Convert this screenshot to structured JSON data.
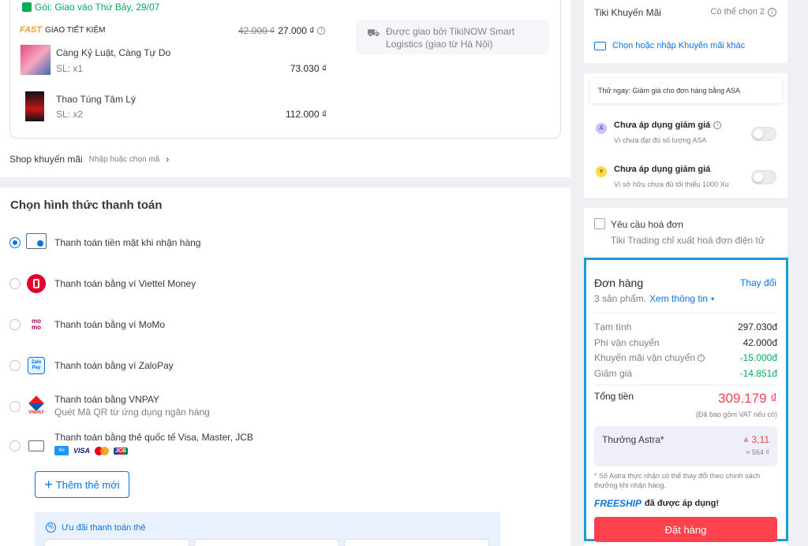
{
  "colors": {
    "accent": "#0b74e5",
    "price_red": "#ff424e",
    "green": "#00ab56",
    "highlight_border": "#1a9bd7",
    "order_button": "#ff424e"
  },
  "package": {
    "delivery_label": "Gói: Giao vào Thứ Bảy, 29/07",
    "fast_tag": "FAST",
    "shipping_method": "GIAO TIẾT KIỆM",
    "old_fee": "42.000 ₫",
    "new_fee": "27.000 ₫",
    "carrier": "Được giao bởi TikiNOW Smart Logistics (giao từ Hà Nội)",
    "items": [
      {
        "name": "Càng Kỷ Luật, Càng Tự Do",
        "qty": "SL: x1",
        "price": "73.030 ₫"
      },
      {
        "name": "Thao Túng Tâm Lý",
        "qty": "SL: x2",
        "price": "112.000 ₫"
      }
    ]
  },
  "shop_promo": {
    "label": "Shop khuyến mãi",
    "hint": "Nhập hoặc chọn mã"
  },
  "payment": {
    "title": "Chọn hình thức thanh toán",
    "options": [
      {
        "label": "Thanh toán tiền mặt khi nhận hàng",
        "icon": "cash-icon"
      },
      {
        "label": "Thanh toán bằng ví Viettel Money",
        "icon": "viettel-money-icon"
      },
      {
        "label": "Thanh toán bằng ví MoMo",
        "icon": "momo-icon",
        "icon_text": "mo mo"
      },
      {
        "label": "Thanh toán bằng ví ZaloPay",
        "icon": "zalopay-icon",
        "icon_text": "Zalo Pay"
      },
      {
        "label": "Thanh toán bằng VNPAY",
        "sub": "Quét Mã QR từ ứng dụng ngân hàng",
        "icon": "vnpay-icon",
        "icon_text": "VNPAY"
      },
      {
        "label": "Thanh toán bằng thẻ quốc tế Visa, Master, JCB",
        "icon": "credit-card-icon",
        "cards": [
          "tiki",
          "VISA",
          "MC",
          "JCB"
        ]
      }
    ],
    "add_card": "Thêm thẻ mới",
    "card_offer": "Ưu đãi thanh toán thẻ"
  },
  "sidebar": {
    "tiki_promo": {
      "label": "Tiki Khuyến Mãi",
      "count": "Có thể chọn 2",
      "link": "Chọn hoặc nhập Khuyến mãi khác"
    },
    "asa": {
      "tip": "Thử ngay: Giảm giá cho đơn hàng bằng ASA",
      "items": [
        {
          "title": "Chưa áp dụng giảm giá",
          "sub": "Vì chưa đạt đủ số lượng ASA"
        },
        {
          "title": "Chưa áp dụng giảm giá",
          "sub": "Vì sở hữu chưa đủ tối thiểu 1000 Xu"
        }
      ]
    },
    "invoice": {
      "label": "Yêu cầu hoá đơn",
      "note": "Tiki Trading chỉ xuất hoá đơn điện tử"
    },
    "order": {
      "title": "Đơn hàng",
      "change": "Thay đổi",
      "products": "3 sản phẩm.",
      "view_info": "Xem thông tin",
      "lines": [
        {
          "label": "Tạm tính",
          "value": "297.030đ"
        },
        {
          "label": "Phí vận chuyển",
          "value": "42.000đ"
        },
        {
          "label": "Khuyến mãi vận chuyển",
          "value": "-15.000đ"
        },
        {
          "label": "Giảm giá",
          "value": "-14.851đ"
        }
      ],
      "total_label": "Tổng tiền",
      "total_value": "309.179 ₫",
      "vat_note": "(Đã bao gồm VAT nếu có)",
      "astra_label": "Thưởng Astra*",
      "astra_value": "3,11",
      "astra_approx": "≈ 564 ₫",
      "astra_note": "* Số Astra thực nhận có thể thay đổi theo chính sách thưởng khi nhận hàng.",
      "freeship": "FREESHIP",
      "freeship_text": "đã được áp dụng!",
      "order_button": "Đặt hàng"
    }
  }
}
